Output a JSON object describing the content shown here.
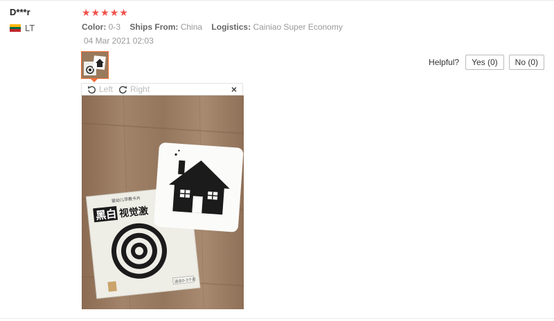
{
  "review": {
    "user": "D***r",
    "country": "LT",
    "rating": 5,
    "meta": {
      "color_label": "Color:",
      "color_value": "0-3",
      "ships_label": "Ships From:",
      "ships_value": "China",
      "logistics_label": "Logistics:",
      "logistics_value": "Cainiao Super Economy"
    },
    "date": "04 Mar 2021 02:03"
  },
  "viewer": {
    "rotate_left": "Left",
    "rotate_right": "Right",
    "close": "×"
  },
  "helpful": {
    "label": "Helpful?",
    "yes": "Yes (0)",
    "no": "No (0)"
  },
  "photo": {
    "book_title_boxed": "黑白",
    "book_title_rest": "视觉激",
    "book_top_text": "婴幼儿早教卡片",
    "book_side_text": "适合0-3个月"
  },
  "colors": {
    "star": "#f0514a",
    "thumb_border": "#f36d37",
    "flag": [
      "#fdb913",
      "#006a44",
      "#c1272d"
    ]
  }
}
